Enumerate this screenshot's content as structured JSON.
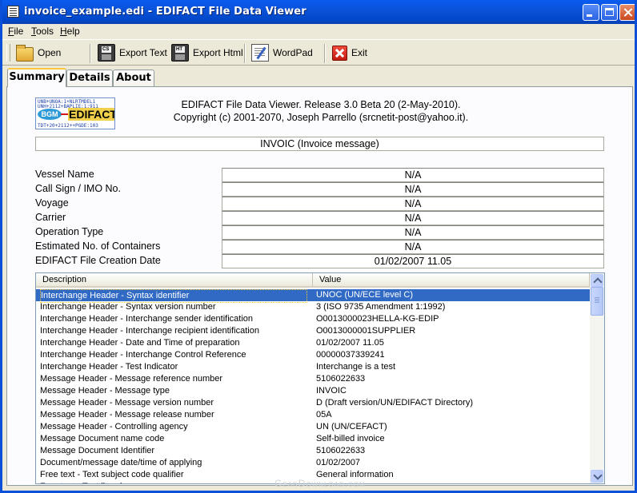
{
  "window": {
    "title": "invoice_example.edi - EDIFACT File Data Viewer"
  },
  "menu": [
    {
      "label": "File",
      "u": "F",
      "rest": "ile"
    },
    {
      "label": "Tools",
      "u": "T",
      "rest": "ools"
    },
    {
      "label": "Help",
      "u": "H",
      "rest": "elp"
    }
  ],
  "toolbar": {
    "open": "Open",
    "export_text": "Export Text",
    "export_html": "Export Html",
    "wordpad": "WordPad",
    "exit": "Exit",
    "export_text_icon": "CS",
    "export_html_icon": "HT"
  },
  "tabs": [
    "Summary",
    "Details",
    "About"
  ],
  "header": {
    "line1": "EDIFACT File Data Viewer. Release 3.0 Beta 20 (2-May-2010).",
    "line2": "Copyright (c) 2001-2070, Joseph Parrello (srcnetit-post@yahoo.it).",
    "message": "INVOIC (Invoice message)"
  },
  "logo": {
    "seg1": "UNB+UNOA:1+NLRTMDEL1",
    "seg2": "UNH+2112+BAPLIE:1:911",
    "seg3": "BGM",
    "seg4": "EDIFACT",
    "seg5": "TDT+20+2112++PGDE:103"
  },
  "fields": [
    {
      "label": "Vessel Name",
      "value": "N/A"
    },
    {
      "label": "Call Sign / IMO No.",
      "value": "N/A"
    },
    {
      "label": "Voyage",
      "value": "N/A"
    },
    {
      "label": "Carrier",
      "value": "N/A"
    },
    {
      "label": "Operation Type",
      "value": "N/A"
    },
    {
      "label": "Estimated No. of Containers",
      "value": "N/A"
    },
    {
      "label": "EDIFACT File Creation Date",
      "value": "01/02/2007 11.05"
    }
  ],
  "list": {
    "columns": [
      "Description",
      "Value"
    ],
    "rows": [
      {
        "d": "Interchange Header - Syntax identifier",
        "v": "UNOC (UN/ECE level C)"
      },
      {
        "d": "Interchange Header - Syntax version number",
        "v": "3 (ISO 9735 Amendment 1:1992)"
      },
      {
        "d": "Interchange Header - Interchange sender identification",
        "v": "O0013000023HELLA-KG-EDIP"
      },
      {
        "d": "Interchange Header - Interchange recipient identification",
        "v": "O0013000001SUPPLIER"
      },
      {
        "d": "Interchange Header - Date and Time of preparation",
        "v": "01/02/2007 11.05"
      },
      {
        "d": "Interchange Header - Interchange Control Reference",
        "v": "00000037339241"
      },
      {
        "d": "Interchange Header - Test Indicator",
        "v": "Interchange is a test"
      },
      {
        "d": "Message Header - Message reference number",
        "v": "5106022633"
      },
      {
        "d": "Message Header - Message type",
        "v": "INVOIC"
      },
      {
        "d": "Message Header - Message version number",
        "v": "D (Draft version/UN/EDIFACT Directory)"
      },
      {
        "d": "Message Header - Message release number",
        "v": "05A"
      },
      {
        "d": "Message Header - Controlling agency",
        "v": "UN (UN/CEFACT)"
      },
      {
        "d": "Message Document name code",
        "v": "Self-billed invoice"
      },
      {
        "d": "Message Document Identifier",
        "v": "5106022633"
      },
      {
        "d": "Document/message date/time of applying",
        "v": "01/02/2007"
      },
      {
        "d": "Free text - Text subject code qualifier",
        "v": "General information"
      },
      {
        "d": "Free text - Text literal",
        "v": ""
      }
    ]
  },
  "watermark": "GearDownload.com"
}
